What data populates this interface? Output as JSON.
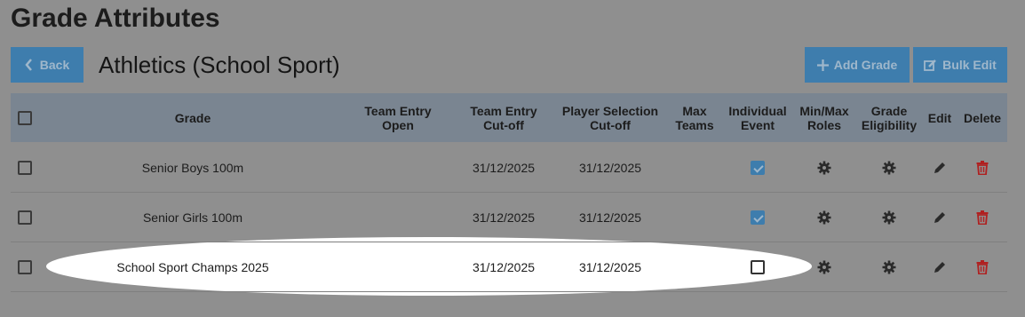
{
  "page": {
    "title": "Grade Attributes"
  },
  "toolbar": {
    "back_label": "Back",
    "sport_title": "Athletics (School Sport)",
    "add_grade_label": "Add Grade",
    "bulk_edit_label": "Bulk Edit"
  },
  "table": {
    "headers": {
      "grade": "Grade",
      "team_entry_open": "Team Entry Open",
      "team_entry_cutoff": "Team Entry Cut-off",
      "player_selection_cutoff": "Player Selection Cut-off",
      "max_teams": "Max Teams",
      "individual_event": "Individual Event",
      "min_max_roles": "Min/Max Roles",
      "grade_eligibility": "Grade Eligibility",
      "edit": "Edit",
      "delete": "Delete"
    },
    "rows": [
      {
        "grade": "Senior Boys 100m",
        "team_entry_open": "",
        "team_entry_cutoff": "31/12/2025",
        "player_selection_cutoff": "31/12/2025",
        "max_teams": "",
        "individual_event": true
      },
      {
        "grade": "Senior Girls 100m",
        "team_entry_open": "",
        "team_entry_cutoff": "31/12/2025",
        "player_selection_cutoff": "31/12/2025",
        "max_teams": "",
        "individual_event": true
      },
      {
        "grade": "School Sport Champs 2025",
        "team_entry_open": "",
        "team_entry_cutoff": "31/12/2025",
        "player_selection_cutoff": "31/12/2025",
        "max_teams": "",
        "individual_event": false
      }
    ]
  },
  "colors": {
    "button": "#3e7dad",
    "header_bg": "#7a8591",
    "delete": "#b02020",
    "page_bg": "#8f8f8f"
  },
  "icons": {
    "back": "chevron-left-icon",
    "add": "plus-icon",
    "bulk": "edit-square-icon",
    "roles": "gear-icon",
    "eligibility": "gear-icon",
    "edit": "pencil-icon",
    "delete": "trash-icon"
  }
}
